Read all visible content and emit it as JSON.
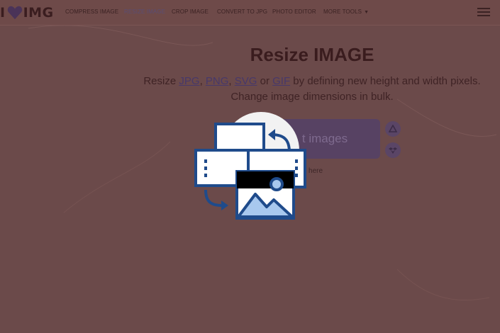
{
  "logo": {
    "prefix": "I",
    "suffix": "IMG"
  },
  "nav": [
    {
      "label": "COMPRESS IMAGE"
    },
    {
      "label": "RESIZE IMAGE"
    },
    {
      "label": "CROP IMAGE"
    },
    {
      "label": "CONVERT TO JPG"
    },
    {
      "label": "PHOTO EDITOR"
    },
    {
      "label": "MORE TOOLS"
    }
  ],
  "hero": {
    "title": "Resize IMAGE",
    "sub_pre": "Resize ",
    "formats": [
      "JPG",
      "PNG",
      "SVG",
      "GIF"
    ],
    "sep1": ", ",
    "sep2": ", ",
    "sep3": " or ",
    "sub_post": " by defining new height and width pixels.",
    "line2": "Change image dimensions in bulk."
  },
  "upload": {
    "button_text": "t images",
    "drop_hint": "images here"
  },
  "colors": {
    "overlay_bg": "#6b4a4a",
    "active_nav": "#5a4d74",
    "button": "#574263",
    "illustration_blue": "#1f4b8b",
    "illustration_light": "#a8c8ee"
  },
  "icons": {
    "logo_heart": "heart-icon",
    "cloud_upload": "google-drive-icon",
    "dropbox": "dropbox-icon",
    "illustration": "resize-image-icon"
  }
}
